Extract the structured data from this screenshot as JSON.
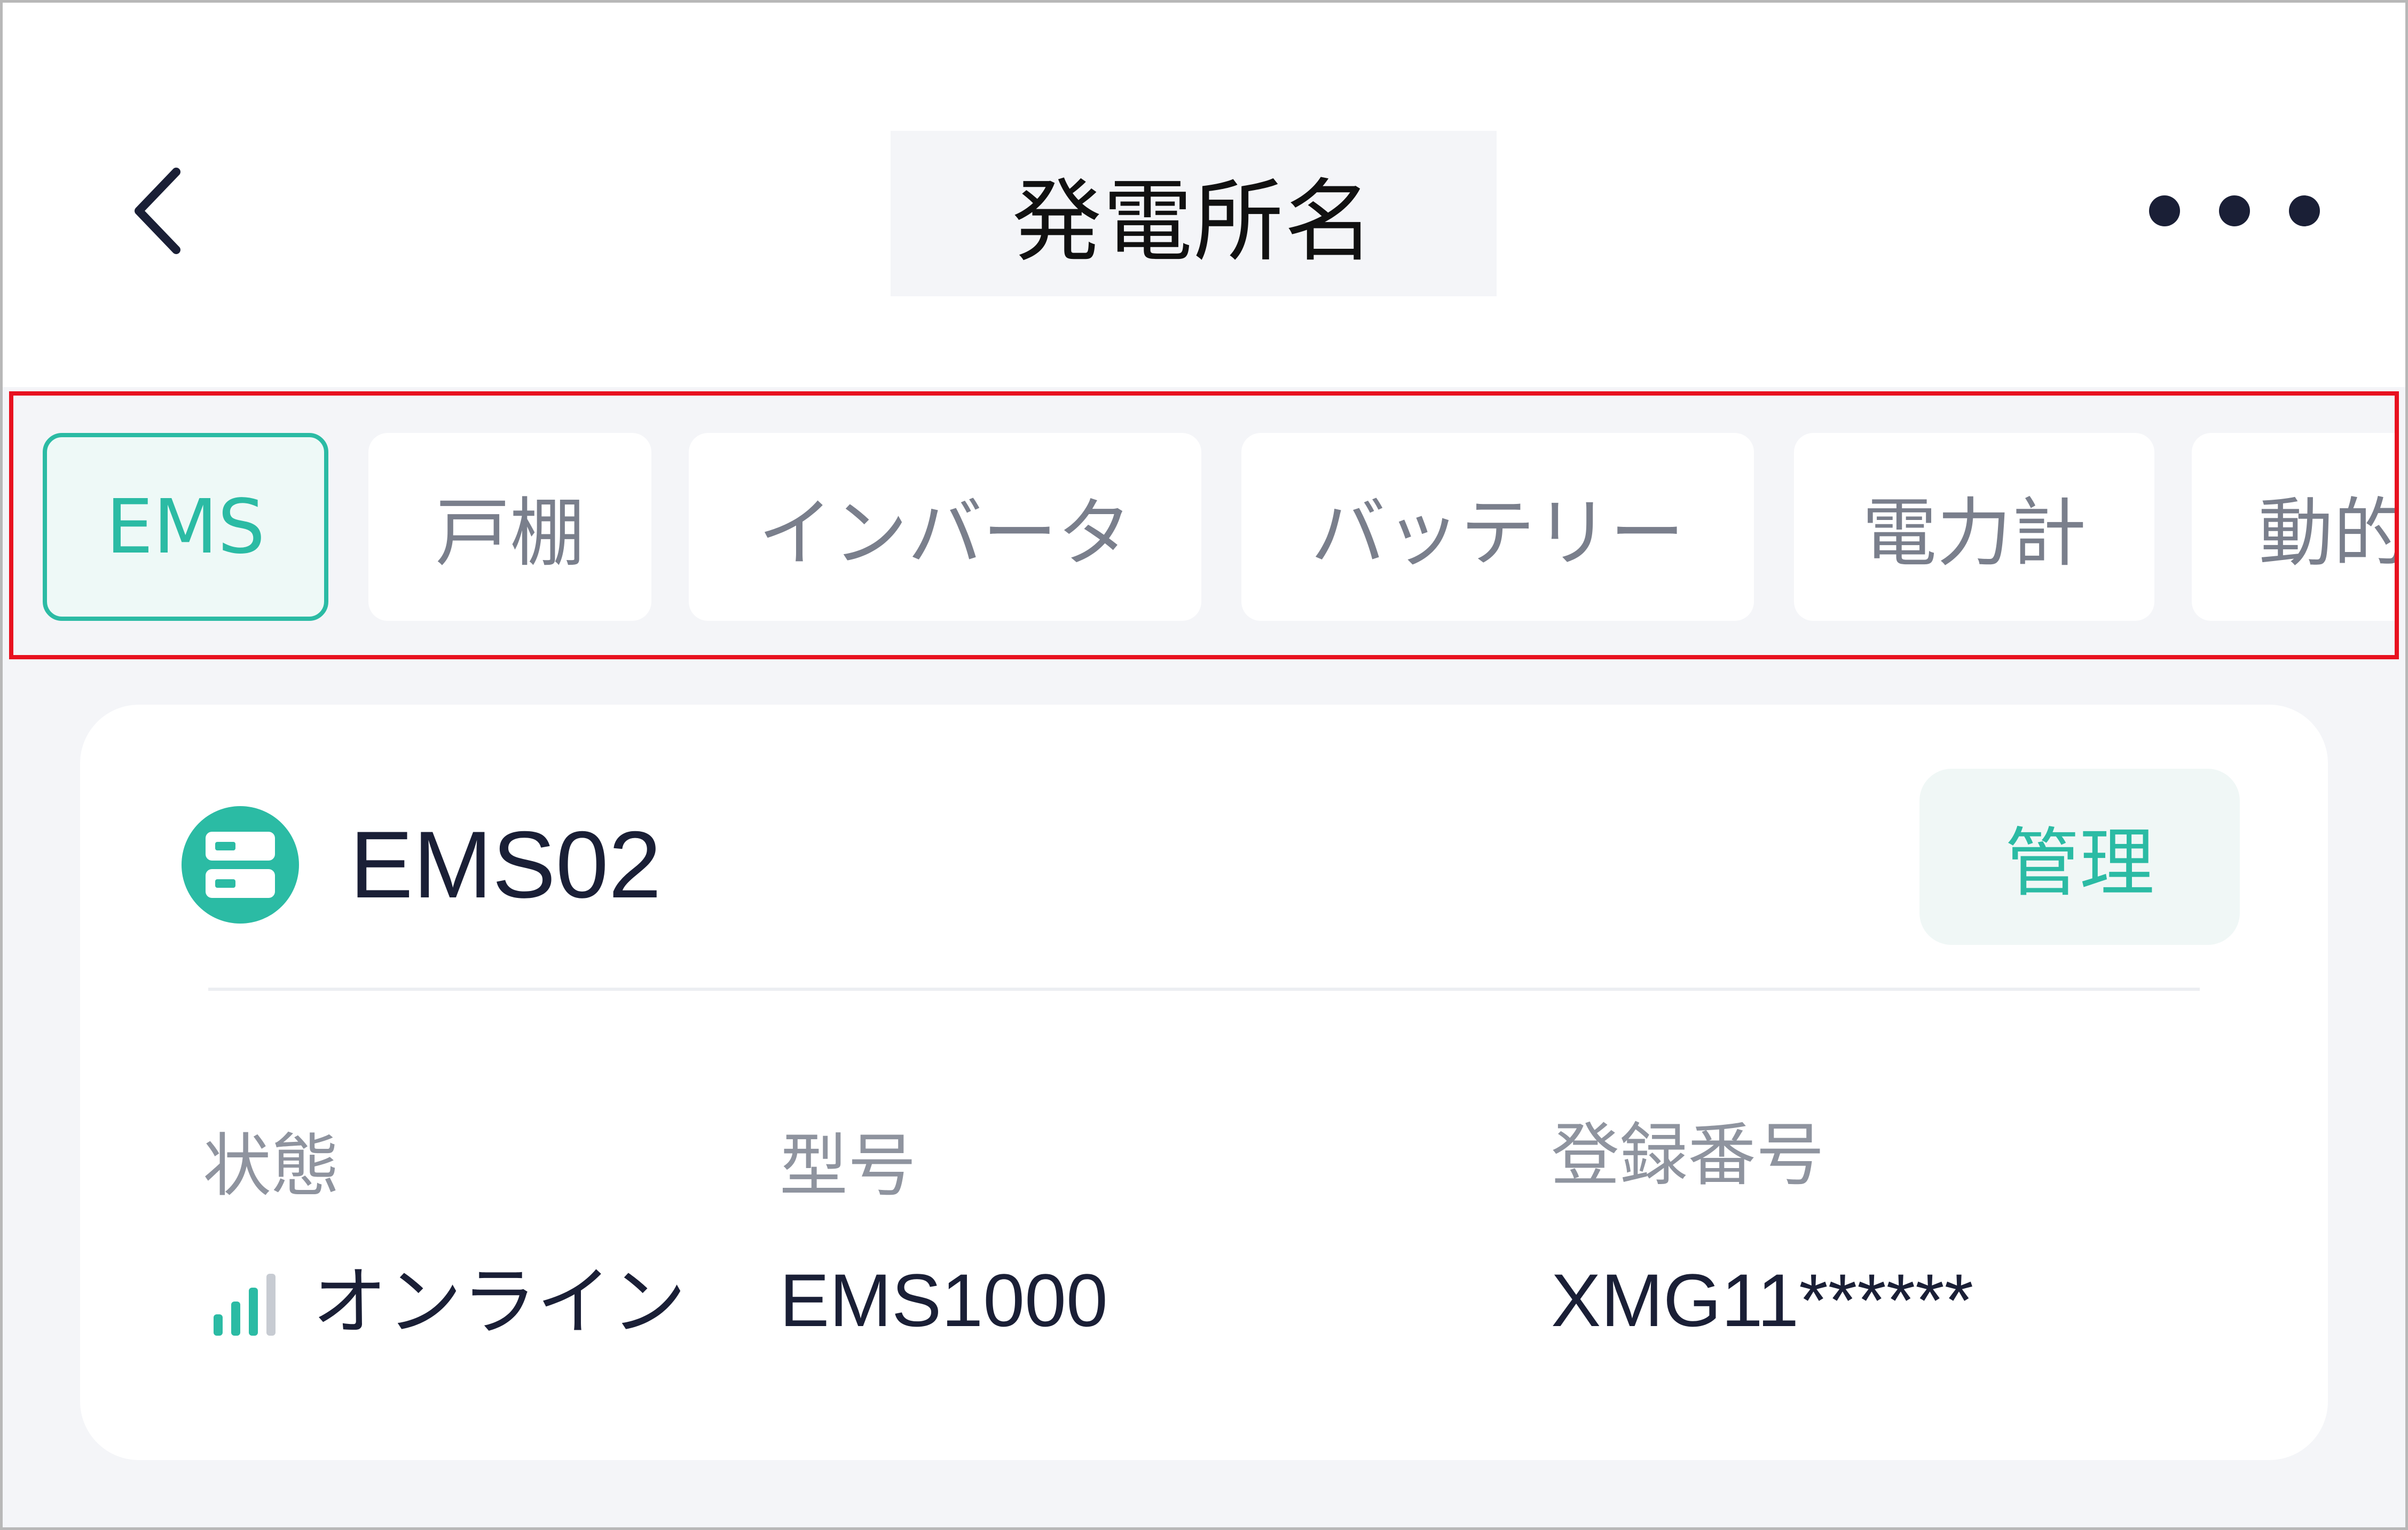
{
  "header": {
    "back_icon": "chevron-left-icon",
    "title": "発電所名",
    "more_icon": "more-horizontal-icon"
  },
  "tabs": [
    {
      "label": "EMS",
      "active": true
    },
    {
      "label": "戸棚",
      "active": false
    },
    {
      "label": "インバータ",
      "active": false
    },
    {
      "label": "バッテリー",
      "active": false
    },
    {
      "label": "電力計",
      "active": false
    },
    {
      "label": "動的",
      "active": false
    }
  ],
  "device": {
    "icon": "server-icon",
    "name": "EMS02",
    "manage_label": "管理",
    "status_label": "状態",
    "status_value": "オンライン",
    "status_icon": "signal-strength-icon",
    "model_label": "型号",
    "model_value": "EMS1000",
    "reg_label": "登録番号",
    "reg_value": "XMG11******"
  },
  "colors": {
    "accent": "#2bbba4",
    "highlight_border": "#e8111f",
    "text_dark": "#1a1f36",
    "text_muted": "#8f949f"
  }
}
